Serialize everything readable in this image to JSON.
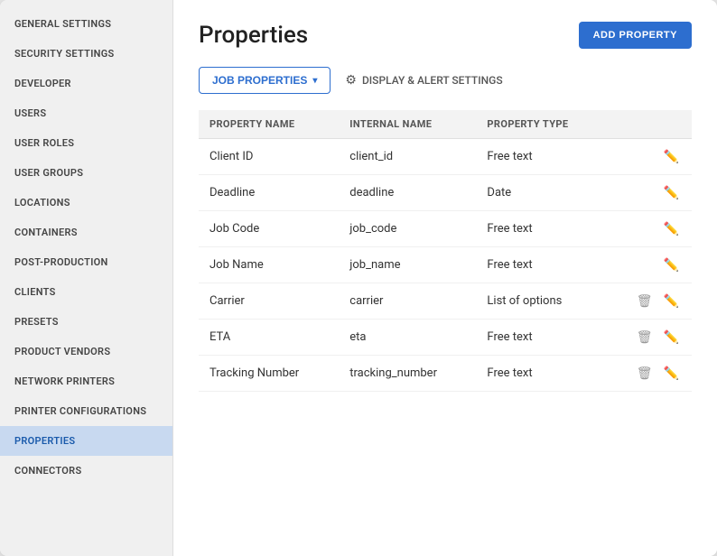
{
  "sidebar": {
    "items": [
      {
        "id": "general-settings",
        "label": "General Settings",
        "active": false
      },
      {
        "id": "security-settings",
        "label": "Security Settings",
        "active": false
      },
      {
        "id": "developer",
        "label": "Developer",
        "active": false
      },
      {
        "id": "users",
        "label": "Users",
        "active": false
      },
      {
        "id": "user-roles",
        "label": "User Roles",
        "active": false
      },
      {
        "id": "user-groups",
        "label": "User Groups",
        "active": false
      },
      {
        "id": "locations",
        "label": "Locations",
        "active": false
      },
      {
        "id": "containers",
        "label": "Containers",
        "active": false
      },
      {
        "id": "post-production",
        "label": "Post-Production",
        "active": false
      },
      {
        "id": "clients",
        "label": "Clients",
        "active": false
      },
      {
        "id": "presets",
        "label": "Presets",
        "active": false
      },
      {
        "id": "product-vendors",
        "label": "Product Vendors",
        "active": false
      },
      {
        "id": "network-printers",
        "label": "Network Printers",
        "active": false
      },
      {
        "id": "printer-configurations",
        "label": "Printer Configurations",
        "active": false
      },
      {
        "id": "properties",
        "label": "Properties",
        "active": true
      },
      {
        "id": "connectors",
        "label": "Connectors",
        "active": false
      }
    ]
  },
  "main": {
    "title": "Properties",
    "add_button_label": "ADD PROPERTY",
    "tabs": [
      {
        "id": "job-properties",
        "label": "JOB PROPERTIES",
        "type": "dropdown",
        "active": true
      },
      {
        "id": "display-alert",
        "label": "DISPLAY & ALERT SETTINGS",
        "type": "link",
        "active": false
      }
    ],
    "table": {
      "columns": [
        {
          "id": "property-name",
          "label": "PROPERTY NAME"
        },
        {
          "id": "internal-name",
          "label": "INTERNAL NAME"
        },
        {
          "id": "property-type",
          "label": "PROPERTY TYPE"
        },
        {
          "id": "actions",
          "label": ""
        }
      ],
      "rows": [
        {
          "property_name": "Client ID",
          "internal_name": "client_id",
          "property_type": "Free text",
          "has_delete": false
        },
        {
          "property_name": "Deadline",
          "internal_name": "deadline",
          "property_type": "Date",
          "has_delete": false
        },
        {
          "property_name": "Job Code",
          "internal_name": "job_code",
          "property_type": "Free text",
          "has_delete": false
        },
        {
          "property_name": "Job Name",
          "internal_name": "job_name",
          "property_type": "Free text",
          "has_delete": false
        },
        {
          "property_name": "Carrier",
          "internal_name": "carrier",
          "property_type": "List of options",
          "has_delete": true
        },
        {
          "property_name": "ETA",
          "internal_name": "eta",
          "property_type": "Free text",
          "has_delete": true
        },
        {
          "property_name": "Tracking Number",
          "internal_name": "tracking_number",
          "property_type": "Free text",
          "has_delete": true
        }
      ]
    }
  },
  "colors": {
    "accent": "#2d6ecf",
    "active_sidebar_bg": "#c8d9f0",
    "active_sidebar_text": "#1a5aab"
  }
}
